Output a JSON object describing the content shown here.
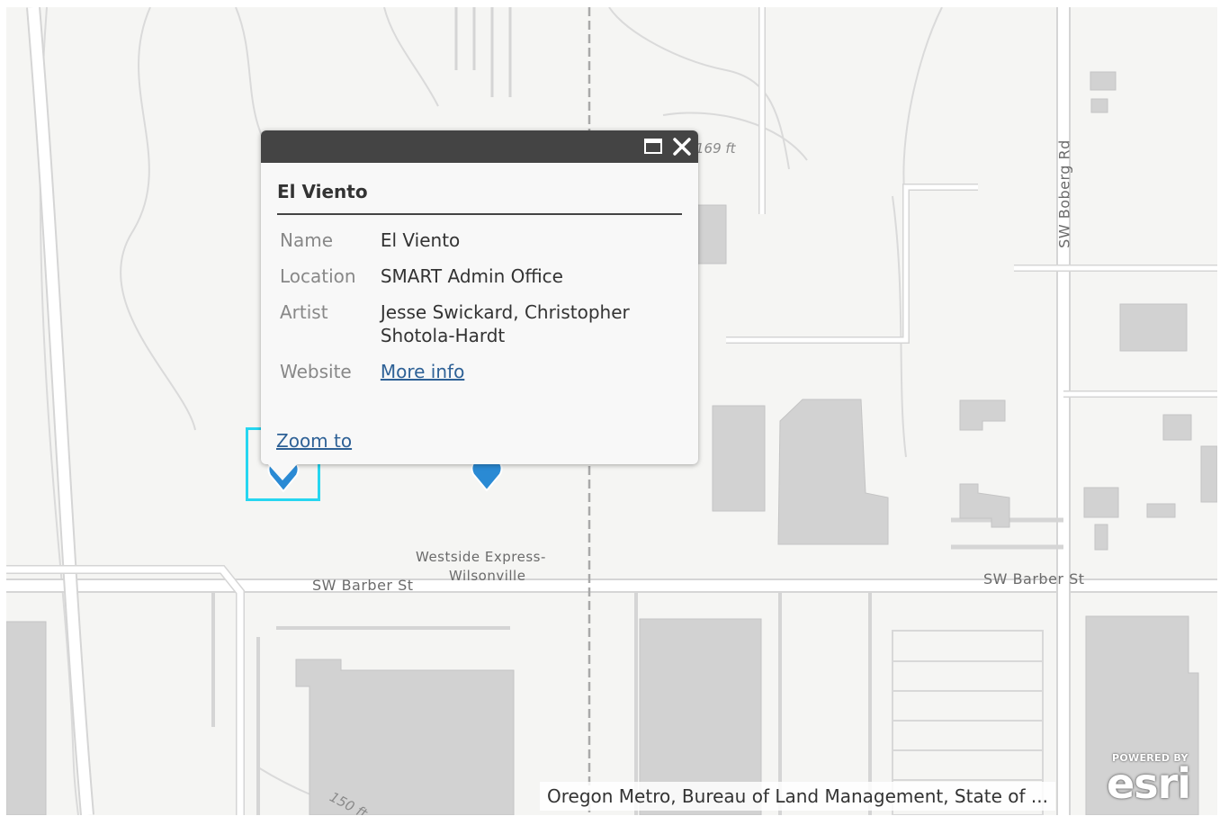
{
  "map": {
    "labels": {
      "road_barber_west": "SW Barber St",
      "road_barber_east": "SW Barber St",
      "road_boberg": "SW Boberg Rd",
      "rail_line_1": "Westside Express-",
      "rail_line_2": "Wilsonville",
      "elevation_top": "169 ft",
      "elevation_bottom": "150 ft"
    },
    "attribution": "Oregon Metro, Bureau of Land Management, State of ...",
    "logo_small": "POWERED BY",
    "logo_main": "esri",
    "pin_color": "#2a8ad4",
    "selection_color": "#26d6f0"
  },
  "popup": {
    "title": "El Viento",
    "fields": [
      {
        "name": "Name",
        "value": "El Viento"
      },
      {
        "name": "Location",
        "value": "SMART Admin Office"
      },
      {
        "name": "Artist",
        "value": "Jesse Swickard, Christopher Shotola-Hardt"
      },
      {
        "name": "Website",
        "value": "More info"
      }
    ],
    "zoom_to": "Zoom to",
    "maximize_icon": "maximize-icon",
    "close_icon": "close-icon"
  }
}
